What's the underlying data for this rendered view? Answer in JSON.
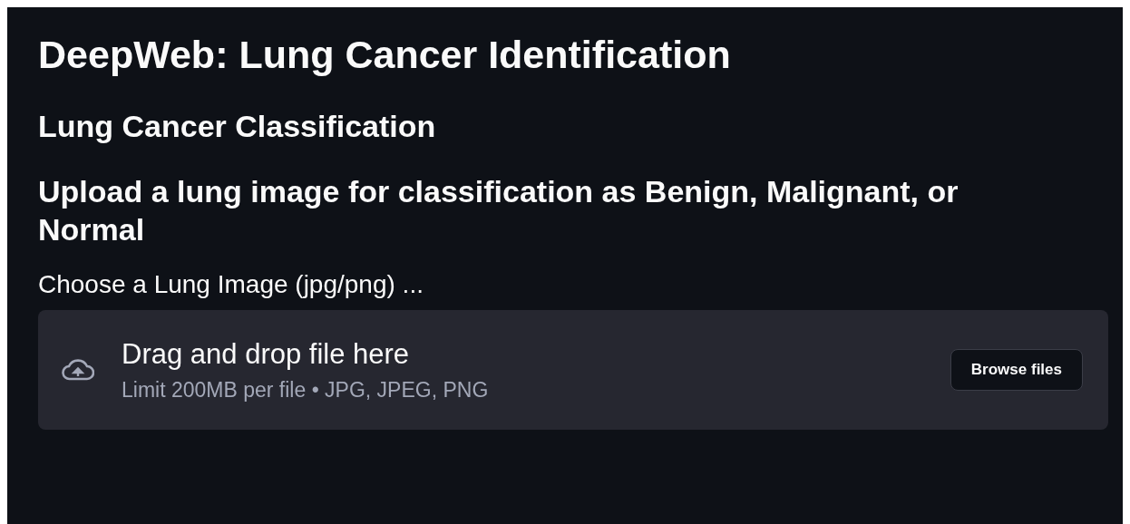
{
  "title": "DeepWeb: Lung Cancer Identification",
  "subtitle": "Lung Cancer Classification",
  "heading": "Upload a lung image for classification as Benign, Malignant, or Normal",
  "uploader": {
    "label": "Choose a Lung Image (jpg/png) ...",
    "prompt": "Drag and drop file here",
    "hint": "Limit 200MB per file • JPG, JPEG, PNG",
    "button": "Browse files"
  }
}
